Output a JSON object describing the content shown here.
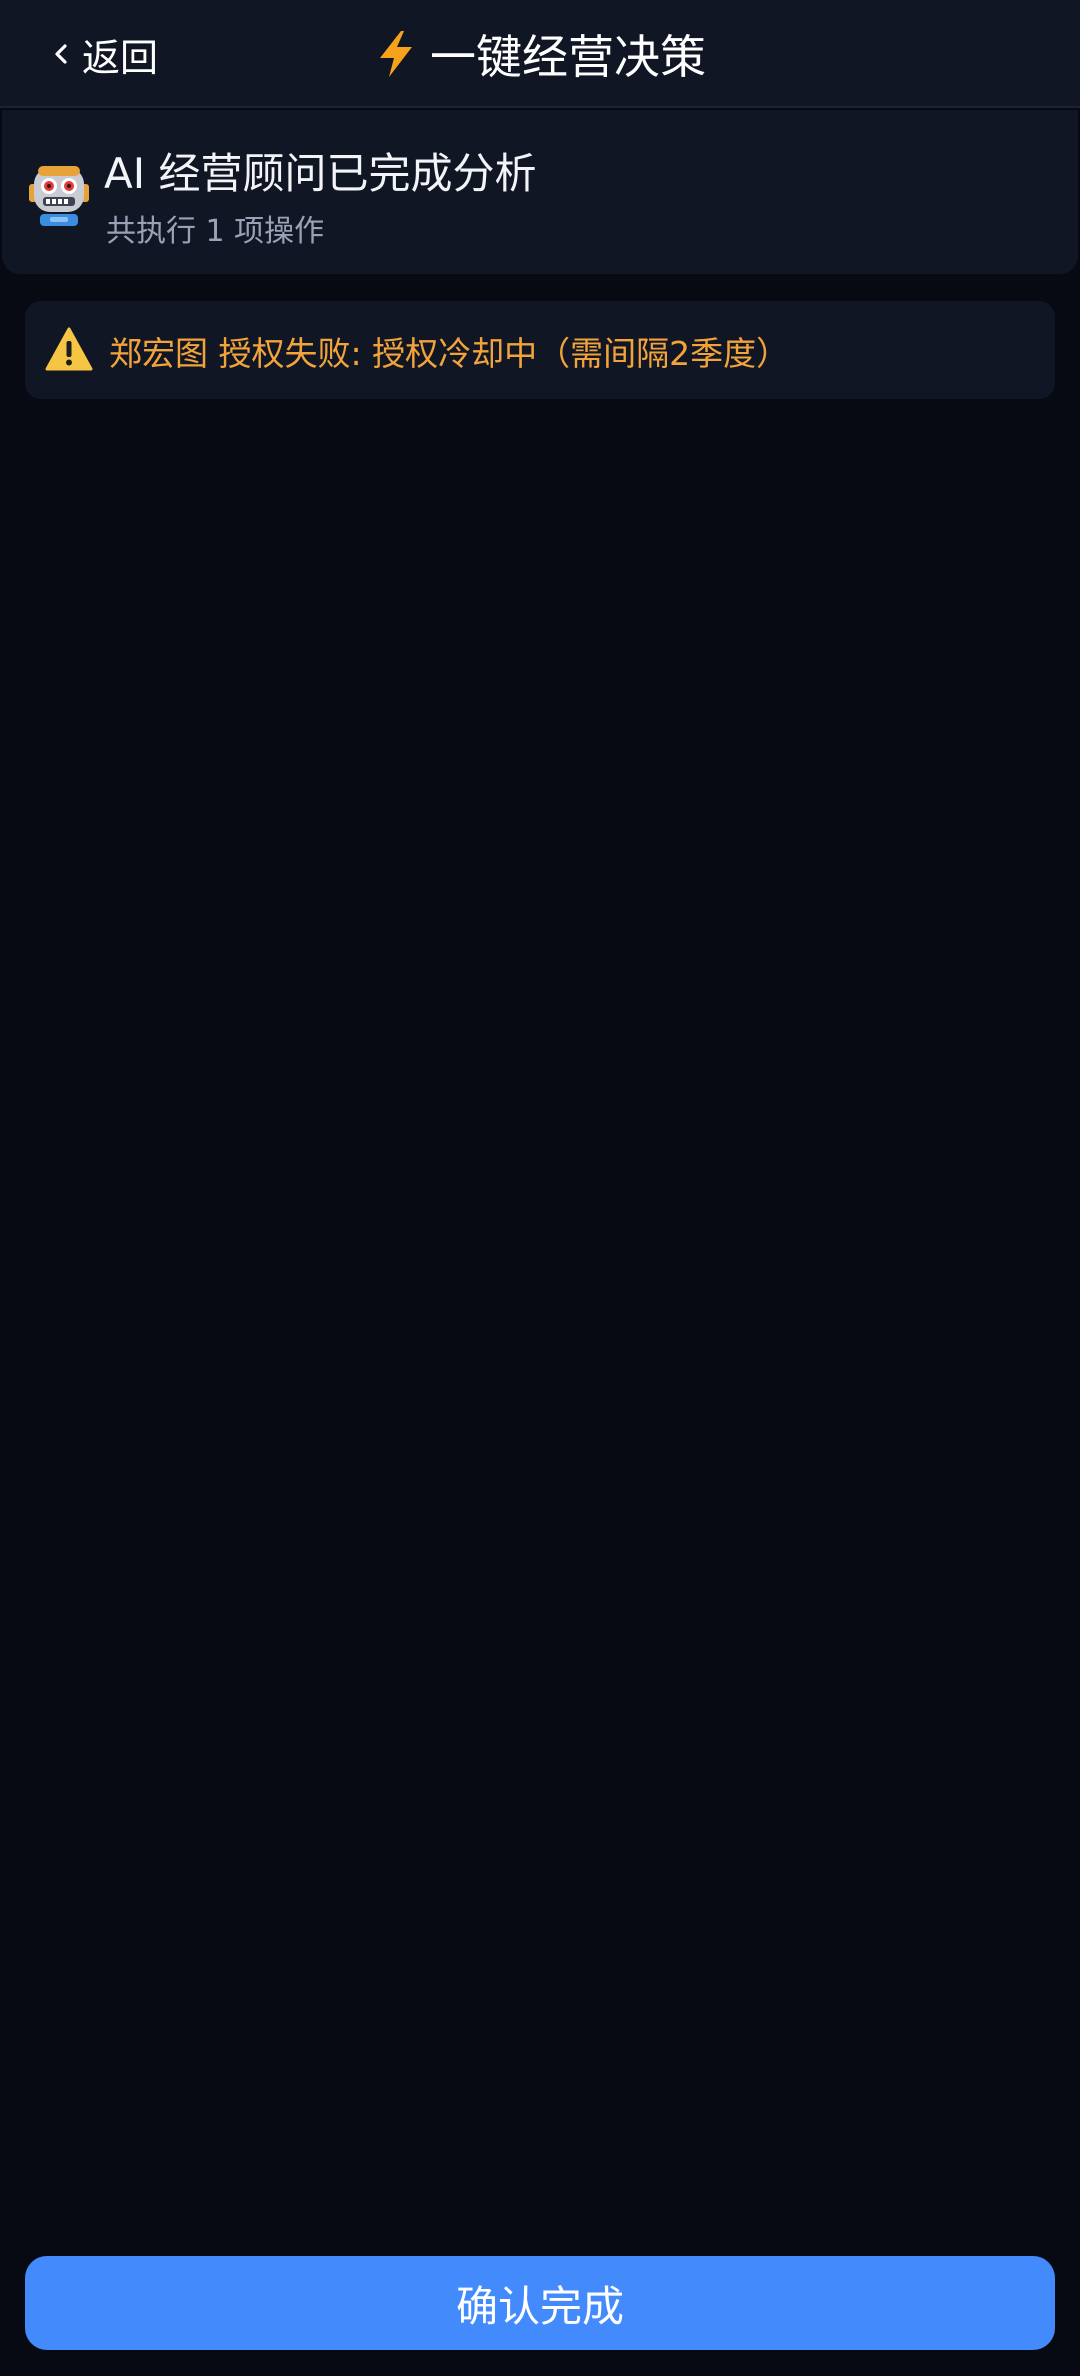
{
  "header": {
    "back_label": "返回",
    "title": "一键经营决策",
    "back_icon": "chevron-left-icon",
    "title_icon": "lightning-bolt-icon"
  },
  "summary": {
    "icon": "robot-icon",
    "title": "AI 经营顾问已完成分析",
    "subtitle": "共执行 1 项操作"
  },
  "results": [
    {
      "icon": "warning-icon",
      "text": "郑宏图 授权失败: 授权冷却中（需间隔2季度）"
    }
  ],
  "footer": {
    "confirm_label": "确认完成"
  },
  "colors": {
    "background": "#070a13",
    "surface": "#111624",
    "warning_text": "#f2a33a",
    "primary_button": "#438bfd",
    "secondary_text": "#9aa1b4"
  }
}
